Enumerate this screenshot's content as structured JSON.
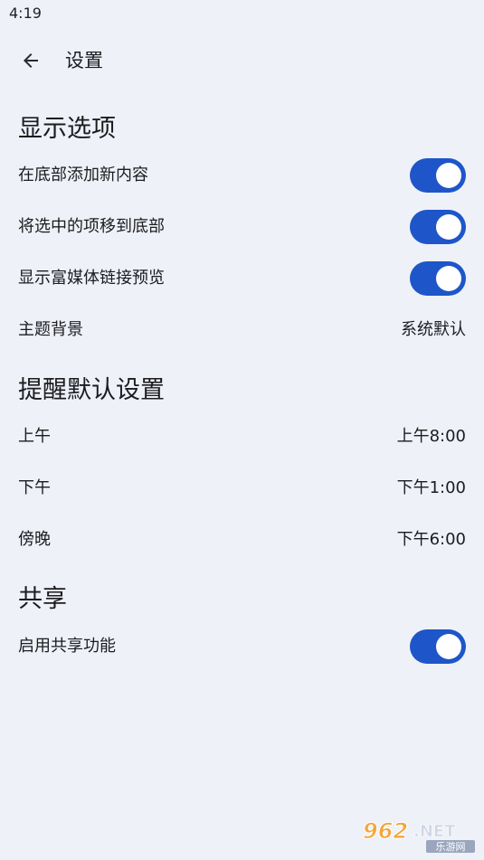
{
  "status_bar": {
    "time": "4:19"
  },
  "header": {
    "title": "设置",
    "back_icon": "arrow-left-icon"
  },
  "sections": [
    {
      "title": "显示选项",
      "items": [
        {
          "label": "在底部添加新内容",
          "type": "toggle",
          "on": true
        },
        {
          "label": "将选中的项移到底部",
          "type": "toggle",
          "on": true
        },
        {
          "label": "显示富媒体链接预览",
          "type": "toggle",
          "on": true
        },
        {
          "label": "主题背景",
          "type": "value",
          "value": "系统默认"
        }
      ]
    },
    {
      "title": "提醒默认设置",
      "items": [
        {
          "label": "上午",
          "type": "value",
          "value": "上午8:00"
        },
        {
          "label": "下午",
          "type": "value",
          "value": "下午1:00"
        },
        {
          "label": "傍晚",
          "type": "value",
          "value": "下午6:00"
        }
      ]
    },
    {
      "title": "共享",
      "items": [
        {
          "label": "启用共享功能",
          "type": "toggle",
          "on": true
        }
      ]
    }
  ],
  "colors": {
    "background": "#eef1f8",
    "toggle_on": "#1e56c9",
    "toggle_thumb": "#ffffff"
  },
  "watermark": {
    "logo_text": "962.NET",
    "sub_text": "乐游网"
  }
}
